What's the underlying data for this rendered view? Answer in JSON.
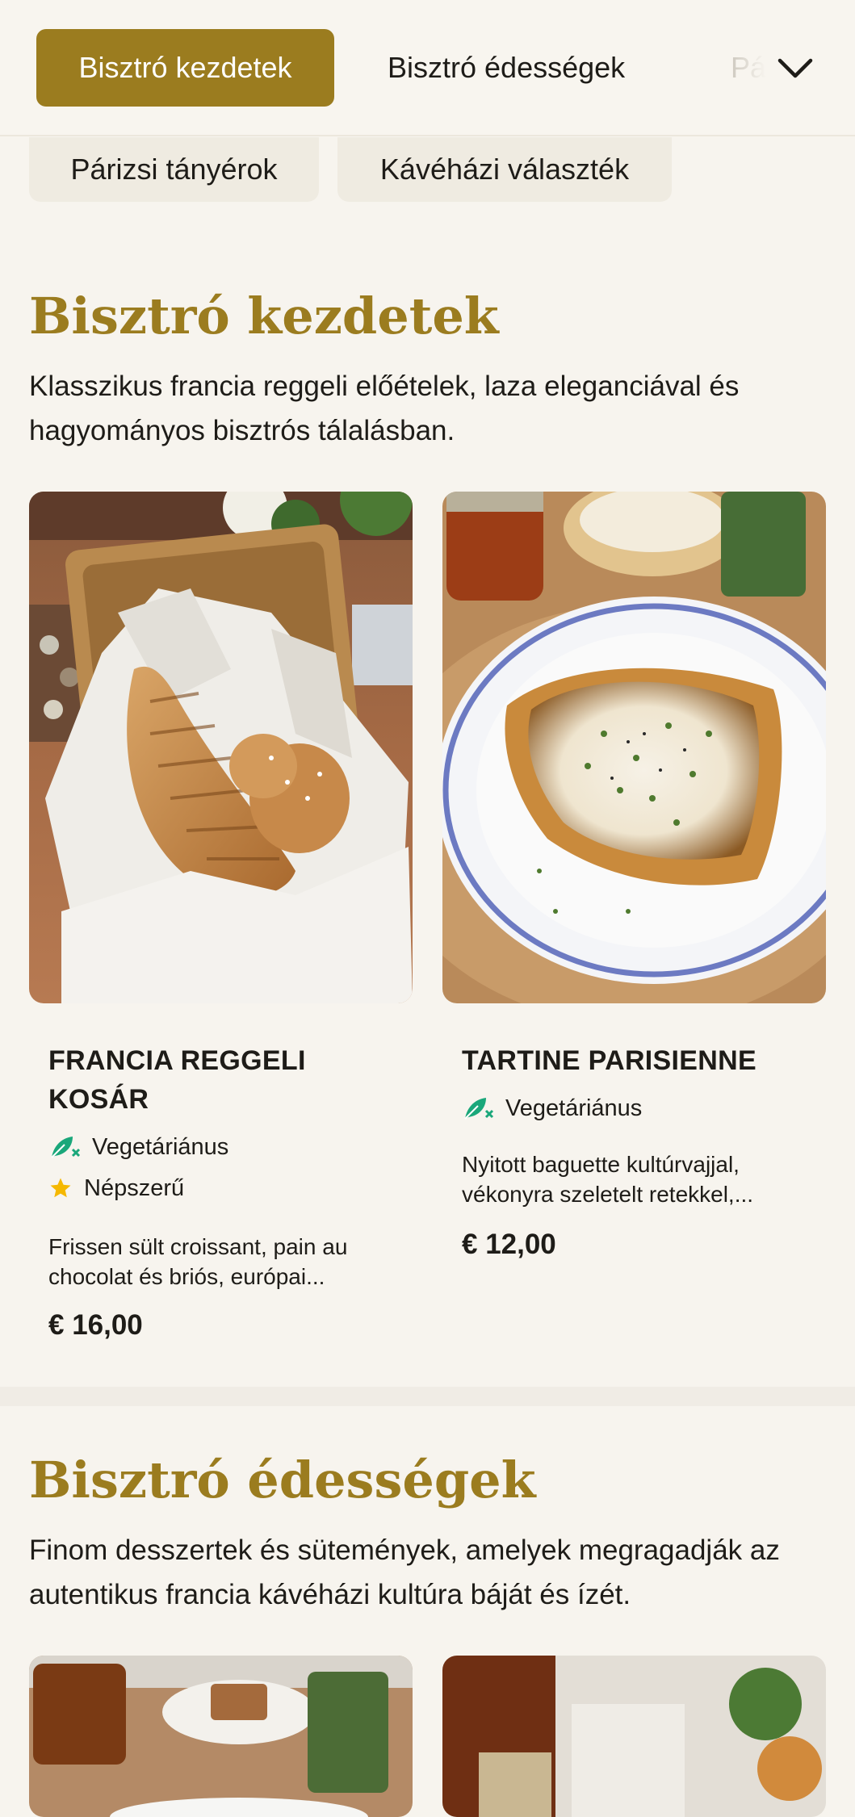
{
  "tabs": {
    "active": "Bisztró kezdetek",
    "second": "Bisztró édességek",
    "third_partial": "Pá"
  },
  "chips": [
    "Párizsi tányérok",
    "Kávéházi választék"
  ],
  "sections": [
    {
      "title": "Bisztró kezdetek",
      "description": "Klasszikus francia reggeli előételek, laza eleganciával és hagyományos bisztrós tálalásban.",
      "items": [
        {
          "name": "FRANCIA REGGELI KOSÁR",
          "tags": [
            "Vegetáriánus",
            "Népszerű"
          ],
          "description": "Frissen sült croissant, pain au chocolat és briós, európai...",
          "price": "€ 16,00"
        },
        {
          "name": "TARTINE PARISIENNE",
          "tags": [
            "Vegetáriánus"
          ],
          "description": "Nyitott baguette kultúrvajjal, vékonyra szeletelt retekkel,...",
          "price": "€ 12,00"
        }
      ]
    },
    {
      "title": "Bisztró édességek",
      "description": "Finom desszertek és sütemények, amelyek megragadják az autentikus francia kávéházi kultúra báját és ízét."
    }
  ],
  "colors": {
    "accent": "#9b7c1f",
    "background": "#f7f4ee",
    "vegetarian_icon": "#1aa77a",
    "popular_icon": "#f5b800"
  },
  "icons": {
    "chevron": "chevron-down-icon",
    "vegetarian": "vegetarian-leaf-icon",
    "popular": "star-icon"
  }
}
